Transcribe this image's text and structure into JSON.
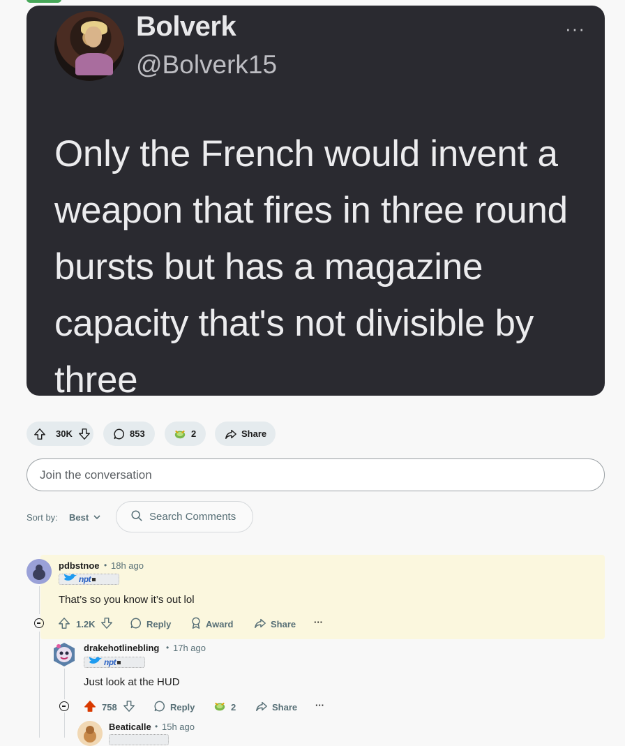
{
  "post": {
    "tweet": {
      "name": "Bolverk",
      "handle": "@Bolverk15",
      "more": "···",
      "text": "Only the French would invent a weapon that fires in three round bursts but has a magazine capacity that's not divisible by three"
    },
    "actions": {
      "votes": "30K",
      "comments": "853",
      "awards": "2",
      "share": "Share"
    }
  },
  "comment_box": {
    "placeholder": "Join the conversation"
  },
  "sort": {
    "label": "Sort by:",
    "value": "Best",
    "search_placeholder": "Search Comments"
  },
  "comments": [
    {
      "author": "pdbstnoe",
      "time": "18h ago",
      "flair": "npt",
      "body": "That’s so you know it’s out lol",
      "votes": "1.2K",
      "reply": "Reply",
      "award": "Award",
      "share": "Share",
      "more": "···"
    },
    {
      "author": "drakehotlinebling",
      "time": "17h ago",
      "flair": "npt",
      "body": "Just look at the HUD",
      "votes": "758",
      "reply": "Reply",
      "awards": "2",
      "share": "Share",
      "more": "···"
    },
    {
      "author": "Beaticalle",
      "time": "15h ago"
    }
  ],
  "colors": {
    "upvoted": "#d93a00",
    "action_bg": "#e5ebee",
    "highlight": "#fbf7de",
    "tweet_bg": "#2a2a30"
  }
}
